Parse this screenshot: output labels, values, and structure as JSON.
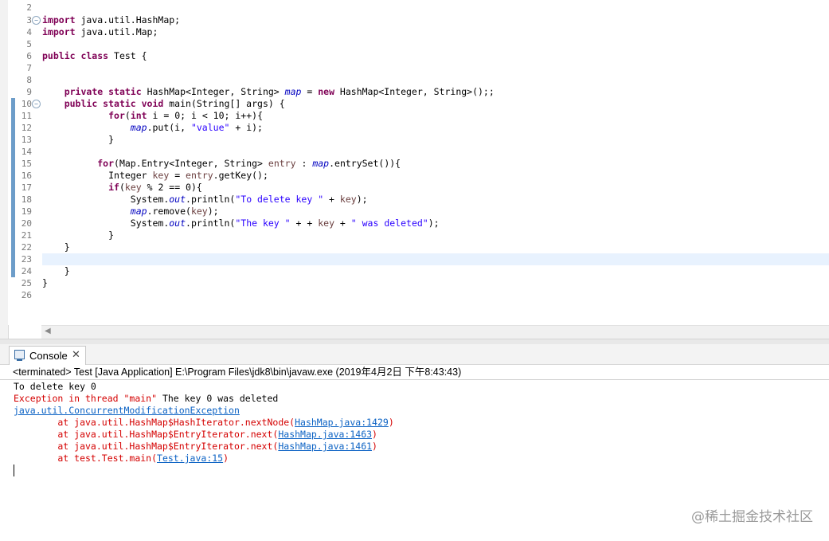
{
  "colors": {
    "keyword": "#7f0055",
    "string": "#2a00ff",
    "field": "#0000c0",
    "local_var": "#6a3e3e",
    "error_text": "#d40000",
    "link": "#0b62c4",
    "change_marker": "#6d9dc9",
    "current_line": "#e8f2fe"
  },
  "editor": {
    "line_numbers": [
      "2",
      "3",
      "4",
      "5",
      "6",
      "7",
      "8",
      "9",
      "10",
      "11",
      "12",
      "13",
      "14",
      "15",
      "16",
      "17",
      "18",
      "19",
      "20",
      "21",
      "22",
      "23",
      "24",
      "25",
      "26"
    ],
    "folded_markers": {
      "3": "−",
      "10": "−"
    },
    "lines": {
      "l2": "",
      "l3_kw": "import",
      "l3_rest": " java.util.HashMap;",
      "l4_kw": "import",
      "l4_rest": " java.util.Map;",
      "l6_kw": "public class",
      "l6_rest": " Test {",
      "l9_kw1": "private static",
      "l9_a": " HashMap<Integer, String> ",
      "l9_field": "map",
      "l9_b": " = ",
      "l9_kw2": "new",
      "l9_c": " HashMap<Integer, String>();;",
      "l10_kw": "public static void",
      "l10_rest": " main(String[] args) {",
      "l11_kw1": "for",
      "l11_a": "(",
      "l11_kw2": "int",
      "l11_rest": " i = 0; i < 10; i++){",
      "l12_field": "map",
      "l12_a": ".put(i, ",
      "l12_str": "\"value\"",
      "l12_b": " + i);",
      "l13": "}",
      "l15_kw": "for",
      "l15_a": "(Map.Entry<Integer, String> ",
      "l15_var": "entry",
      "l15_b": " : ",
      "l15_field": "map",
      "l15_c": ".entrySet()){",
      "l16_a": "Integer ",
      "l16_var1": "key",
      "l16_b": " = ",
      "l16_var2": "entry",
      "l16_c": ".getKey();",
      "l17_kw": "if",
      "l17_a": "(",
      "l17_var": "key",
      "l17_b": " % 2 == 0){",
      "l18_a": "System.",
      "l18_field": "out",
      "l18_b": ".println(",
      "l18_str": "\"To delete key \"",
      "l18_c": " + ",
      "l18_var": "key",
      "l18_d": ");",
      "l19_field": "map",
      "l19_a": ".remove(",
      "l19_var": "key",
      "l19_b": ");",
      "l20_a": "System.",
      "l20_field": "out",
      "l20_b": ".println(",
      "l20_str1": "\"The key \"",
      "l20_c": " + + ",
      "l20_var": "key",
      "l20_d": " + ",
      "l20_str2": "\" was deleted\"",
      "l20_e": ");",
      "l21": "}",
      "l22": "}",
      "l24": "}",
      "l25": "}"
    }
  },
  "console": {
    "tab_label": "Console",
    "close_glyph": "✕",
    "header": "<terminated> Test [Java Application] E:\\Program Files\\jdk8\\bin\\javaw.exe (2019年4月2日 下午8:43:43)",
    "out1": "To delete key 0",
    "err1": "Exception in thread \"main\" ",
    "out2": "The key 0 was deleted",
    "exception_class": "java.util.ConcurrentModificationException",
    "trace": [
      {
        "prefix": "\tat java.util.HashMap$HashIterator.nextNode(",
        "link": "HashMap.java:1429",
        "suffix": ")"
      },
      {
        "prefix": "\tat java.util.HashMap$EntryIterator.next(",
        "link": "HashMap.java:1463",
        "suffix": ")"
      },
      {
        "prefix": "\tat java.util.HashMap$EntryIterator.next(",
        "link": "HashMap.java:1461",
        "suffix": ")"
      },
      {
        "prefix": "\tat test.Test.main(",
        "link": "Test.java:15",
        "suffix": ")"
      }
    ]
  },
  "watermark": "@稀土掘金技术社区"
}
